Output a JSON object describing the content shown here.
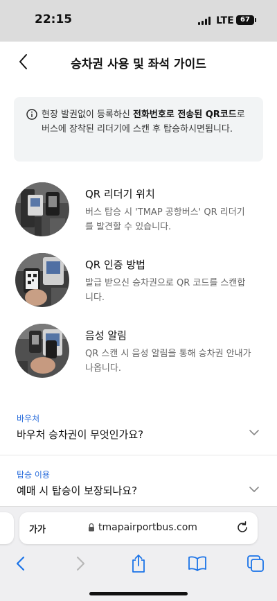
{
  "status": {
    "time": "22:15",
    "network": "LTE",
    "battery": "67"
  },
  "header": {
    "title": "승차권 사용 및 좌석 가이드"
  },
  "notice": {
    "text_pre": "현장 발권없이 등록하신 ",
    "text_bold": "전화번호로 전송된 QR코드",
    "text_post": "로 버스에 장착된 리더기에 스캔 후 탑승하시면됩니다."
  },
  "guides": [
    {
      "title": "QR 리더기 위치",
      "desc": "버스 탑승 시 'TMAP 공항버스' QR 리더기를 발견할 수 있습니다."
    },
    {
      "title": "QR 인증 방법",
      "desc": "발급 받으신 승차권으로 QR 코드를 스캔합니다."
    },
    {
      "title": "음성 알림",
      "desc": "QR 스캔 시 음성 알림을 통해 승차권 안내가 나옵니다."
    }
  ],
  "faq": [
    {
      "category": "바우처",
      "question": "바우처 승차권이 무엇인가요?"
    },
    {
      "category": "탑승 이용",
      "question": "예매 시 탑승이 보장되나요?"
    }
  ],
  "browser": {
    "text_size_label": "가가",
    "url": "tmapairportbus.com"
  },
  "colors": {
    "accent": "#2a6ddb",
    "ios_blue": "#1a73e8",
    "status_bg": "#dcdcdc",
    "notice_bg": "#f2f4f5"
  }
}
